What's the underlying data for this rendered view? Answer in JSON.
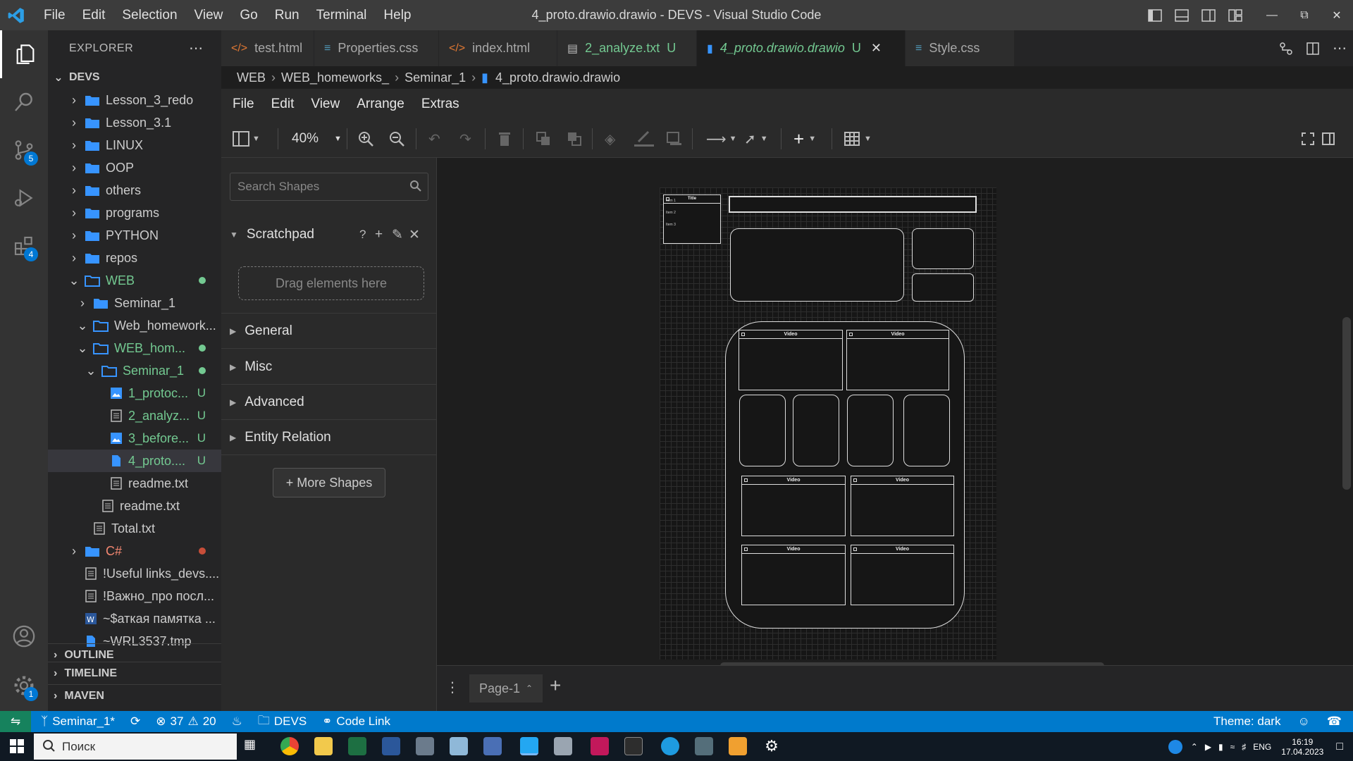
{
  "titlebar": {
    "menu": [
      "File",
      "Edit",
      "Selection",
      "View",
      "Go",
      "Run",
      "Terminal",
      "Help"
    ],
    "title": "4_proto.drawio.drawio - DEVS - Visual Studio Code"
  },
  "activity": {
    "scm_badge": "5",
    "extensions_badge": "4",
    "settings_badge": "1"
  },
  "sidebar": {
    "header": "EXPLORER",
    "root": "DEVS",
    "items": [
      {
        "label": "Lesson_3_redo",
        "kind": "folder"
      },
      {
        "label": "Lesson_3.1",
        "kind": "folder"
      },
      {
        "label": "LINUX",
        "kind": "folder"
      },
      {
        "label": "OOP",
        "kind": "folder"
      },
      {
        "label": "others",
        "kind": "folder"
      },
      {
        "label": "programs",
        "kind": "folder"
      },
      {
        "label": "PYTHON",
        "kind": "folder"
      },
      {
        "label": "repos",
        "kind": "folder"
      },
      {
        "label": "WEB",
        "kind": "folder-open"
      },
      {
        "label": "Seminar_1",
        "kind": "folder"
      },
      {
        "label": "Web_homework...",
        "kind": "folder-open"
      },
      {
        "label": "WEB_hom...",
        "kind": "folder-open"
      },
      {
        "label": "Seminar_1",
        "kind": "folder-open"
      },
      {
        "label": "1_protoc...",
        "kind": "image",
        "badge": "U"
      },
      {
        "label": "2_analyz...",
        "kind": "text",
        "badge": "U"
      },
      {
        "label": "3_before...",
        "kind": "image",
        "badge": "U"
      },
      {
        "label": "4_proto....",
        "kind": "file",
        "badge": "U"
      },
      {
        "label": "readme.txt",
        "kind": "text"
      },
      {
        "label": "readme.txt",
        "kind": "text"
      },
      {
        "label": "Total.txt",
        "kind": "text"
      },
      {
        "label": "C#",
        "kind": "folder"
      },
      {
        "label": "!Useful links_devs....",
        "kind": "text"
      },
      {
        "label": "!Важно_про посл...",
        "kind": "text"
      },
      {
        "label": "~$аткая памятка ...",
        "kind": "word"
      },
      {
        "label": "~WRL3537.tmp",
        "kind": "file"
      }
    ],
    "sections": [
      "OUTLINE",
      "TIMELINE",
      "MAVEN"
    ]
  },
  "tabs": [
    {
      "label": "test.html",
      "icon": "html-icon"
    },
    {
      "label": "Properties.css",
      "icon": "css-icon"
    },
    {
      "label": "index.html",
      "icon": "html-icon"
    },
    {
      "label": "2_analyze.txt",
      "icon": "text-icon",
      "badge": "U"
    },
    {
      "label": "4_proto.drawio.drawio",
      "icon": "file-icon",
      "badge": "U",
      "active": true
    },
    {
      "label": "Style.css",
      "icon": "css-icon"
    }
  ],
  "breadcrumb": [
    "WEB",
    "WEB_homeworks_",
    "Seminar_1",
    "4_proto.drawio.drawio"
  ],
  "drawio": {
    "menu": [
      "File",
      "Edit",
      "View",
      "Arrange",
      "Extras"
    ],
    "zoom": "40%",
    "search_placeholder": "Search Shapes",
    "scratchpad": "Scratchpad",
    "scratchpad_actions": "?",
    "drag_hint": "Drag elements here",
    "palettes": [
      "General",
      "Misc",
      "Advanced",
      "Entity Relation"
    ],
    "more_shapes": "+ More Shapes",
    "page_tab": "Page-1",
    "diagram": {
      "list_title": "Title",
      "list_items": [
        "Item 1",
        "Item 2",
        "Item 3"
      ],
      "video_label": "Video"
    }
  },
  "statusbar": {
    "branch": "Seminar_1*",
    "errors": "37",
    "warnings": "20",
    "folder": "DEVS",
    "codelink": "Code Link",
    "theme": "Theme: dark"
  },
  "taskbar": {
    "search": "Поиск",
    "lang": "ENG",
    "time": "16:19",
    "date": "17.04.2023"
  }
}
